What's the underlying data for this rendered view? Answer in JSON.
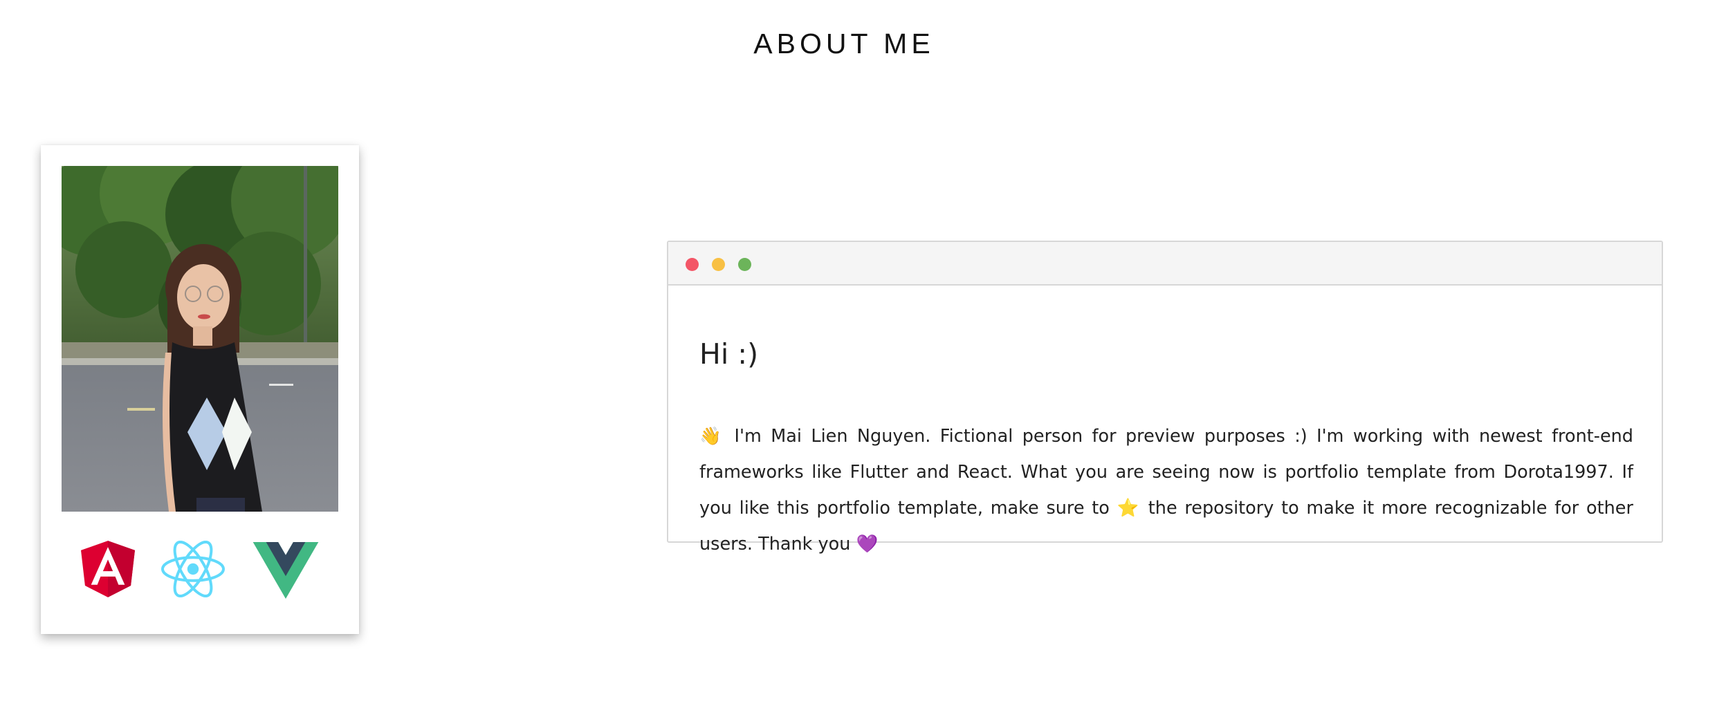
{
  "section": {
    "title": "ABOUT ME"
  },
  "profile": {
    "photo_alt": "Mai Lien Nguyen",
    "tech_icons": [
      "angular-icon",
      "react-icon",
      "vue-icon"
    ]
  },
  "window": {
    "greeting": "Hi :)",
    "bio_wave": "👋",
    "bio_part1": " I'm Mai Lien Nguyen. Fictional person for preview purposes :) I'm working with newest front-end frameworks like Flutter and React. What you are seeing now is portfolio template from Dorota1997. If you like this portfolio template, make sure to ",
    "bio_star": "⭐",
    "bio_part2": " the repository to make it more recognizable for other users. Thank you ",
    "bio_heart": "💜"
  },
  "colors": {
    "dot_red": "#f35667",
    "dot_yellow": "#f8c044",
    "dot_green": "#6cb45a",
    "angular": "#dd0031",
    "react": "#61dafb",
    "vue_green": "#41b883",
    "vue_dark": "#34495e"
  }
}
